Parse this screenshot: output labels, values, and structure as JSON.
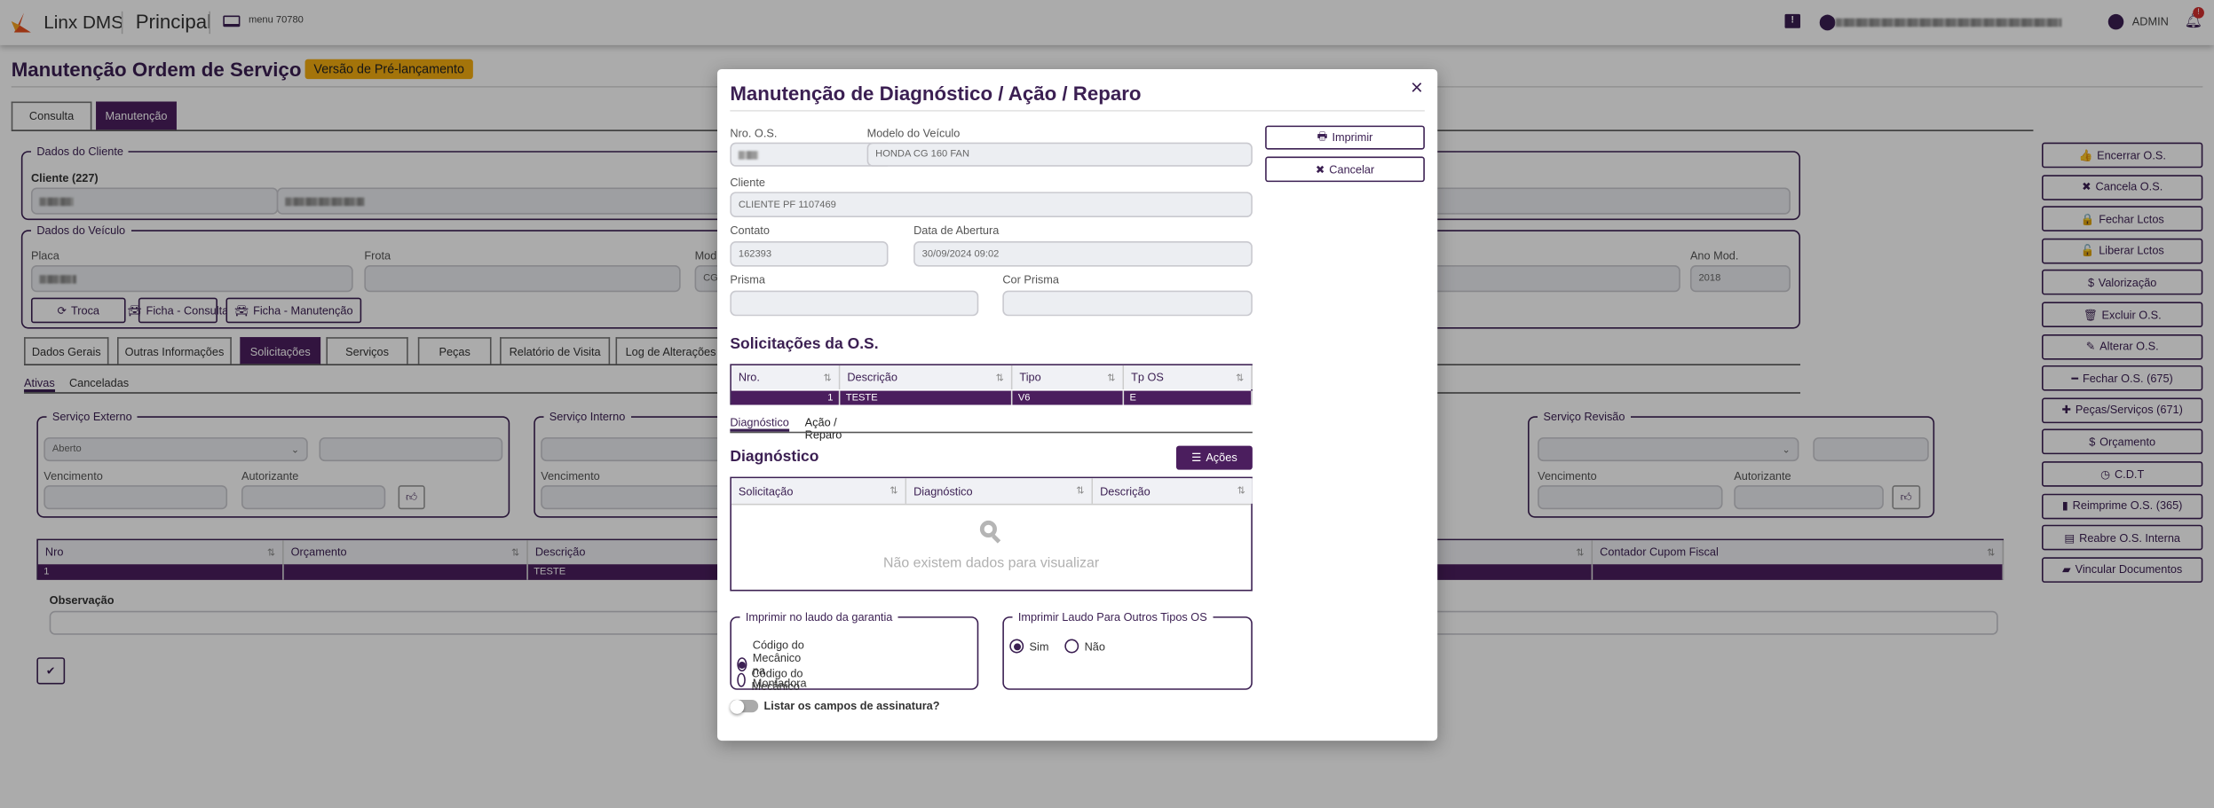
{
  "header": {
    "brand": "Linx DMS",
    "module": "Principal",
    "menu": "menu 70780",
    "user": "ADMIN",
    "notification_badge": "!"
  },
  "page": {
    "title": "Manutenção Ordem de Serviço",
    "badge": "Versão de Pré-lançamento",
    "tabs": [
      "Consulta",
      "Manutenção"
    ]
  },
  "cliente": {
    "legend": "Dados do Cliente",
    "label": "Cliente (227)"
  },
  "veiculo": {
    "legend": "Dados do Veículo",
    "placa": "Placa",
    "frota": "Frota",
    "modelo": "Mod",
    "modelo_value": "CG",
    "ano_mod": "Ano Mod.",
    "ano_mod_value": "2018",
    "buttons": [
      "Troca",
      "Ficha - Consulta",
      "Ficha - Manutenção"
    ]
  },
  "subtabs": [
    "Dados Gerais",
    "Outras Informações",
    "Solicitações",
    "Serviços",
    "Peças",
    "Relatório de Visita",
    "Log de Alterações"
  ],
  "status_tabs": [
    "Ativas",
    "Canceladas"
  ],
  "servicos": {
    "externo": "Serviço Externo",
    "interno": "Serviço Interno",
    "revisao": "Serviço Revisão",
    "select_value": "Aberto",
    "vencimento": "Vencimento",
    "autorizante": "Autorizante"
  },
  "main_table": {
    "columns": [
      "Nro",
      "Orçamento",
      "Descrição",
      "Contador Cupom Fiscal"
    ],
    "rows": [
      [
        "1",
        "",
        "TESTE",
        ""
      ]
    ]
  },
  "observacao": "Observação",
  "side_buttons": [
    {
      "label": "Encerrar O.S.",
      "icon": "👍"
    },
    {
      "label": "Cancela O.S.",
      "icon": "✖"
    },
    {
      "label": "Fechar Lctos",
      "icon": "🔒"
    },
    {
      "label": "Liberar Lctos",
      "icon": "🔓"
    },
    {
      "label": "Valorização",
      "icon": "$"
    },
    {
      "label": "Excluir O.S.",
      "icon": "🗑"
    },
    {
      "label": "Alterar O.S.",
      "icon": "✎"
    },
    {
      "label": "Fechar O.S. (675)",
      "icon": "━"
    },
    {
      "label": "Peças/Serviços (671)",
      "icon": "✚"
    },
    {
      "label": "Orçamento",
      "icon": "$"
    },
    {
      "label": "C.D.T",
      "icon": "◷"
    },
    {
      "label": "Reimprime O.S. (365)",
      "icon": "▮"
    },
    {
      "label": "Reabre O.S. Interna",
      "icon": "▤"
    },
    {
      "label": "Vincular Documentos",
      "icon": "▰"
    }
  ],
  "modal": {
    "title": "Manutenção de Diagnóstico / Ação / Reparo",
    "close": "×",
    "nro_os_label": "Nro. O.S.",
    "modelo_label": "Modelo do Veículo",
    "modelo_value": "HONDA CG 160 FAN",
    "cliente_label": "Cliente",
    "cliente_value": "CLIENTE PF 1107469",
    "contato_label": "Contato",
    "contato_value": "162393",
    "data_label": "Data de Abertura",
    "data_value": "30/09/2024 09:02",
    "prisma_label": "Prisma",
    "cor_prisma_label": "Cor Prisma",
    "imprimir": "Imprimir",
    "cancelar": "Cancelar",
    "solicitacoes_title": "Solicitações da O.S.",
    "sol_columns": [
      "Nro.",
      "Descrição",
      "Tipo",
      "Tp OS"
    ],
    "sol_rows": [
      [
        "1",
        "TESTE",
        "V6",
        "E"
      ]
    ],
    "tabs": [
      "Diagnóstico",
      "Ação / Reparo"
    ],
    "diag_title": "Diagnóstico",
    "acoes": "Ações",
    "diag_columns": [
      "Solicitação",
      "Diagnóstico",
      "Descrição"
    ],
    "empty": "Não existem dados para visualizar",
    "garantia_legend": "Imprimir no laudo da garantia",
    "garantia_options": [
      "Código do Mecânico na Montadora",
      "Código do Mecânico"
    ],
    "garantia_selected": 0,
    "outros_legend": "Imprimir Laudo Para Outros Tipos OS",
    "outros_options": [
      "Sim",
      "Não"
    ],
    "outros_selected": 0,
    "toggle_label": "Listar os campos de assinatura?",
    "toggle_on": false
  },
  "colors": {
    "primary": "#4b1e5e",
    "badge": "#f5ad0f",
    "accent": "#e8501e",
    "alert": "#d32f2f"
  }
}
